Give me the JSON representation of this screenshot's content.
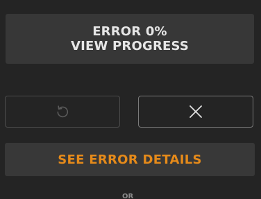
{
  "status": {
    "line1": "ERROR 0%",
    "line2": "VIEW PROGRESS"
  },
  "actions": {
    "retry_icon": "retry-icon",
    "close_icon": "close-icon",
    "error_details_label": "SEE ERROR DETAILS"
  },
  "footer": {
    "partial_text": "OR"
  },
  "colors": {
    "background": "#242424",
    "card": "#373737",
    "text": "#e6e6e6",
    "accent": "#e58a1a"
  }
}
